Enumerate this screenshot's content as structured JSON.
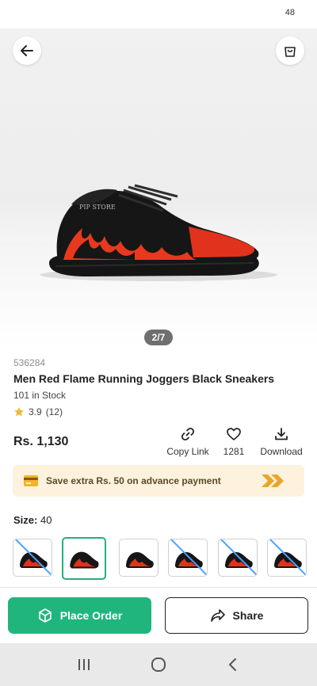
{
  "status": {
    "battery": "48"
  },
  "gallery": {
    "counter": "2/7",
    "watermark": "PIP STORE"
  },
  "product": {
    "sku": "536284",
    "title": "Men Red Flame Running Joggers Black Sneakers",
    "stock": "101 in Stock",
    "rating": "3.9",
    "rating_count": "(12)",
    "price": "Rs. 1,130"
  },
  "actions": {
    "copy_link": "Copy Link",
    "likes": "1281",
    "download": "Download"
  },
  "promo": {
    "text": "Save extra Rs. 50 on advance payment"
  },
  "size": {
    "label": "Size:",
    "value": "40"
  },
  "buttons": {
    "place_order": "Place Order",
    "share": "Share"
  },
  "colors": {
    "accent": "#21b57e",
    "promo_bg": "#fdf2dd",
    "promo_arrow": "#e8a62a",
    "unavailable": "#4aa3ff"
  },
  "icons": [
    "back-arrow-icon",
    "shopping-bag-icon",
    "star-icon",
    "link-icon",
    "heart-icon",
    "download-icon",
    "card-icon",
    "double-chevron-icon",
    "cube-icon",
    "share-icon",
    "recents-icon",
    "home-icon",
    "back-icon"
  ]
}
